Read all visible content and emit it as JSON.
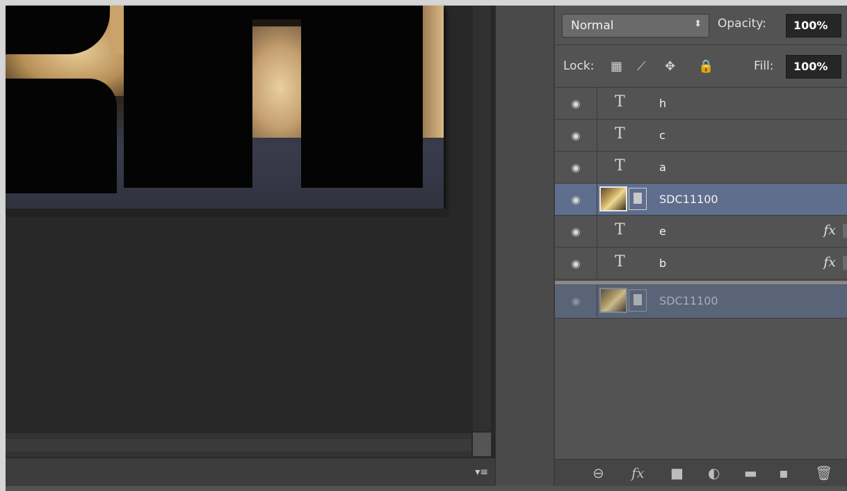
{
  "layers_panel": {
    "blend_mode": "Normal",
    "blend_arrows": "⬍",
    "opacity_label": "Opacity:",
    "opacity_value": "100%",
    "lock_label": "Lock:",
    "fill_label": "Fill:",
    "fill_value": "100%",
    "layers": [
      {
        "name": "h",
        "kind": "text",
        "type_glyph": "T",
        "visible": true,
        "fx": ""
      },
      {
        "name": "c",
        "kind": "text",
        "type_glyph": "T",
        "visible": true,
        "fx": ""
      },
      {
        "name": "a",
        "kind": "text",
        "type_glyph": "T",
        "visible": true,
        "fx": ""
      },
      {
        "name": "SDC11100",
        "kind": "smart-object",
        "visible": true,
        "selected": true,
        "fx": ""
      },
      {
        "name": "e",
        "kind": "text",
        "type_glyph": "T",
        "visible": true,
        "fx": "fx"
      },
      {
        "name": "b",
        "kind": "text",
        "type_glyph": "T",
        "visible": true,
        "fx": "fx"
      },
      {
        "name": "SDC11100",
        "kind": "smart-object",
        "visible": true,
        "clipping_base": true,
        "fx": ""
      }
    ],
    "footer_icons": [
      "link-icon",
      "fx-icon",
      "mask-icon",
      "adjustment-icon",
      "folder-icon",
      "new-layer-icon",
      "trash-icon"
    ],
    "footer_glyphs": [
      "⊖",
      "fx",
      "■",
      "◐",
      "▬",
      "▪",
      "🗑"
    ]
  },
  "status_bar": {
    "menu_glyph": "▾≡"
  },
  "colors": {
    "selected_row": "#5f6e8c",
    "panel_bg": "#535353",
    "canvas_bg": "#282828"
  }
}
